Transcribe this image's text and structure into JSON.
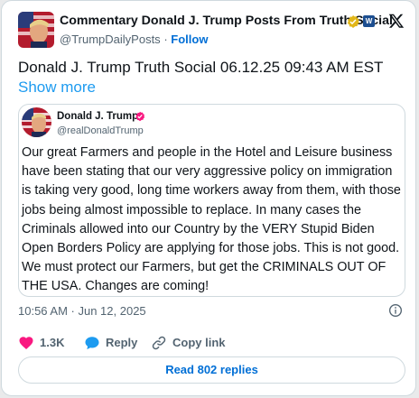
{
  "post": {
    "author_name": "Commentary Donald J. Trump Posts From Truth Social",
    "affiliate_badge": "W",
    "handle": "@TrumpDailyPosts",
    "separator": "·",
    "follow_label": "Follow",
    "text": "Donald J. Trump Truth Social 06.12.25 09:43 AM EST",
    "show_more_label": "Show more",
    "timestamp": "10:56 AM · Jun 12, 2025"
  },
  "quote": {
    "name": "Donald J. Trump",
    "handle": "@realDonaldTrump",
    "text": "Our great Farmers and people in the Hotel and Leisure business have been stating that our very aggressive policy on immigration is taking very good, long time workers away from them, with those jobs being almost impossible to replace. In many cases the Criminals allowed into our Country by the VERY Stupid Biden Open Borders Policy are applying for those jobs. This is not good. We must protect our Farmers, but get the CRIMINALS OUT OF THE USA. Changes are coming!"
  },
  "actions": {
    "like_count": "1.3K",
    "reply_label": "Reply",
    "copy_link_label": "Copy link"
  },
  "replies_button_label": "Read 802 replies",
  "icons": {
    "verified_gold": "verified-gold-icon",
    "verified_pink": "verified-pink-icon",
    "x_logo": "x-logo-icon",
    "info": "info-icon",
    "heart": "heart-icon",
    "reply": "reply-bubble-icon",
    "link": "link-icon"
  },
  "colors": {
    "link_blue": "#006fd6",
    "like_red": "#f91880",
    "verified_gold": "#e2b719",
    "verified_pink": "#f91880",
    "reply_blue": "#1d9bf0",
    "text": "#0f1419",
    "muted": "#536471"
  }
}
